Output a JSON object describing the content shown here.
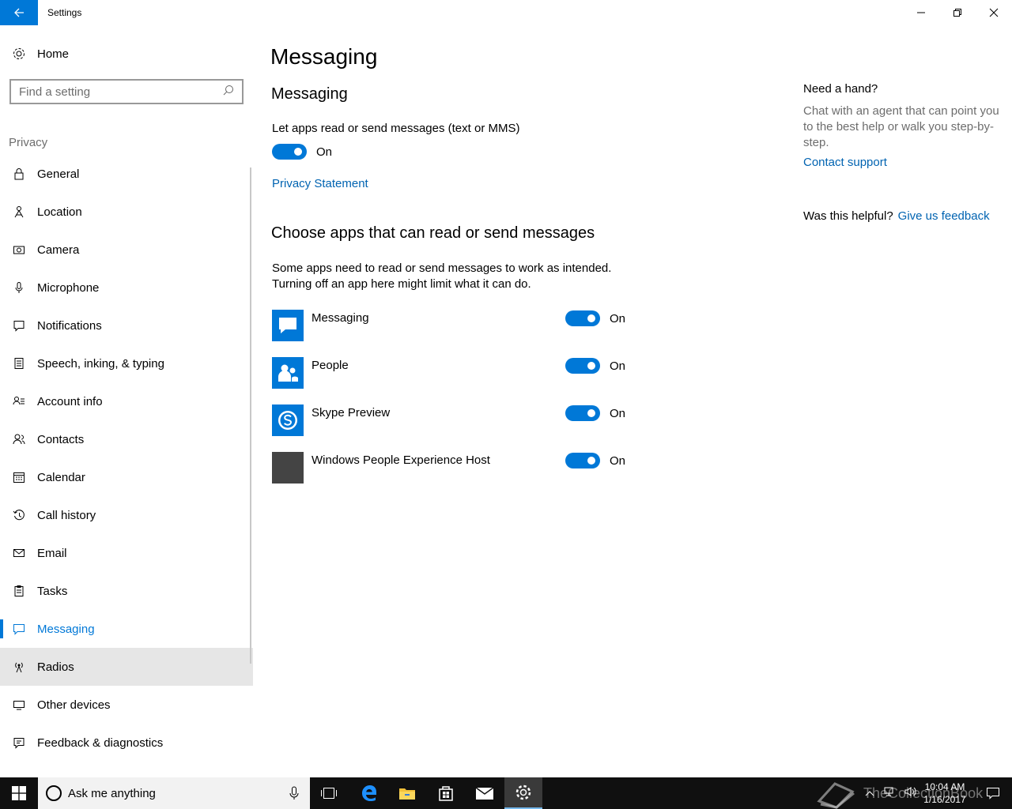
{
  "window": {
    "title": "Settings"
  },
  "sidebar": {
    "home_label": "Home",
    "search_placeholder": "Find a setting",
    "section_label": "Privacy",
    "items": [
      {
        "label": "General",
        "icon": "lock-icon"
      },
      {
        "label": "Location",
        "icon": "location-icon"
      },
      {
        "label": "Camera",
        "icon": "camera-icon"
      },
      {
        "label": "Microphone",
        "icon": "microphone-icon"
      },
      {
        "label": "Notifications",
        "icon": "notifications-icon"
      },
      {
        "label": "Speech, inking, & typing",
        "icon": "speech-icon"
      },
      {
        "label": "Account info",
        "icon": "account-info-icon"
      },
      {
        "label": "Contacts",
        "icon": "contacts-icon"
      },
      {
        "label": "Calendar",
        "icon": "calendar-icon"
      },
      {
        "label": "Call history",
        "icon": "call-history-icon"
      },
      {
        "label": "Email",
        "icon": "email-icon"
      },
      {
        "label": "Tasks",
        "icon": "tasks-icon"
      },
      {
        "label": "Messaging",
        "icon": "messaging-icon",
        "selected": true
      },
      {
        "label": "Radios",
        "icon": "radios-icon",
        "hover": true
      },
      {
        "label": "Other devices",
        "icon": "other-devices-icon"
      },
      {
        "label": "Feedback & diagnostics",
        "icon": "feedback-icon"
      }
    ]
  },
  "main": {
    "page_title": "Messaging",
    "sub_title": "Messaging",
    "description": "Let apps read or send messages (text or MMS)",
    "master_toggle_label": "On",
    "privacy_link": "Privacy Statement",
    "section_title": "Choose apps that can read or send messages",
    "intro_line1": "Some apps need to read or send messages to work as intended.",
    "intro_line2": "Turning off an app here might limit what it can do.",
    "apps": [
      {
        "name": "Messaging",
        "toggle": "On",
        "tile_color": "#0078d7",
        "icon": "messaging-app-icon"
      },
      {
        "name": "People",
        "toggle": "On",
        "tile_color": "#0078d7",
        "icon": "people-app-icon"
      },
      {
        "name": "Skype Preview",
        "toggle": "On",
        "tile_color": "#0078d7",
        "icon": "skype-app-icon"
      },
      {
        "name": "Windows People Experience Host",
        "toggle": "On",
        "tile_color": "#444444",
        "icon": "windows-people-host-icon"
      }
    ]
  },
  "help": {
    "title": "Need a hand?",
    "text": "Chat with an agent that can point you to the best help or walk you step-by-step.",
    "link": "Contact support",
    "helpful_question": "Was this helpful?",
    "feedback_link": "Give us feedback"
  },
  "taskbar": {
    "search_text": "Ask me anything",
    "time": "10:04 AM",
    "date": "1/16/2017",
    "watermark": "TheCollectionBook"
  },
  "colors": {
    "accent": "#0078d7",
    "link": "#0063b1",
    "hover_bg": "#e6e6e6",
    "taskbar_bg": "#101010"
  }
}
